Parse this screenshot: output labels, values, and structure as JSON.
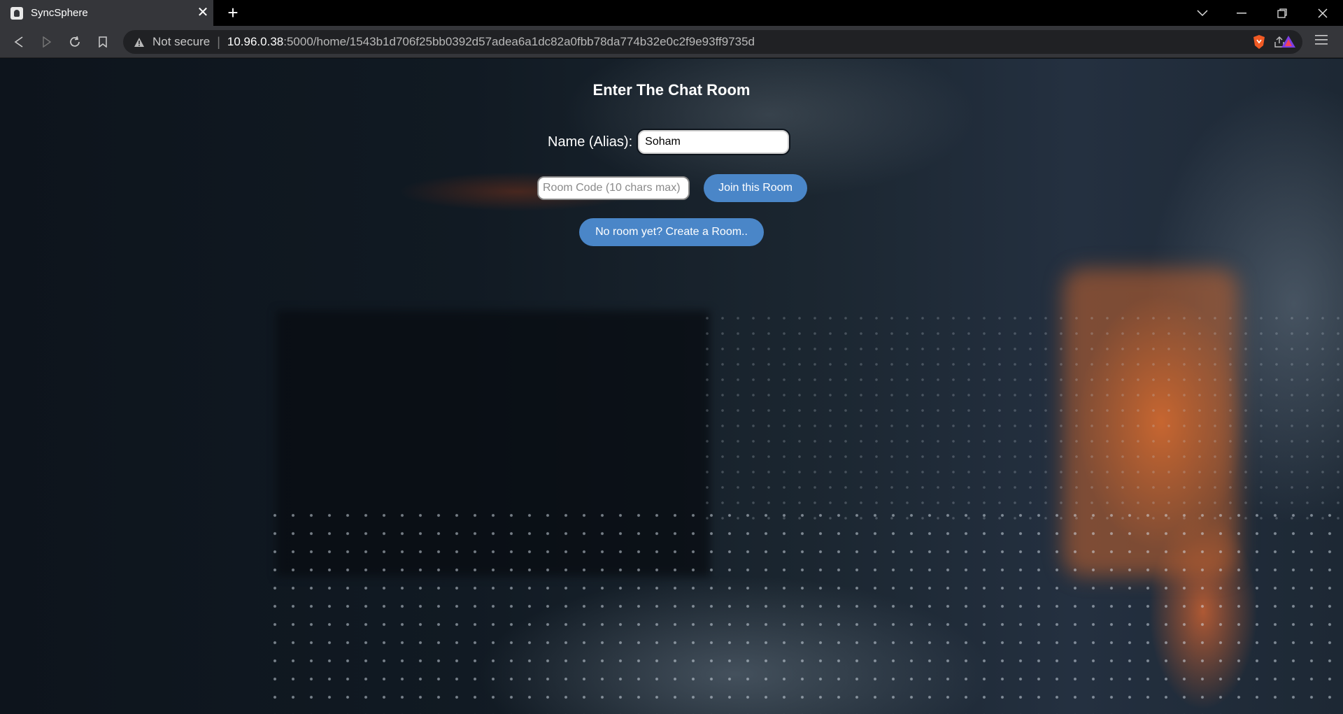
{
  "browser": {
    "tab_title": "SyncSphere",
    "tab_close": "✕",
    "new_tab": "+",
    "security_label": "Not secure",
    "url_host": "10.96.0.38",
    "url_rest": ":5000/home/1543b1d706f25bb0392d57adea6a1dc82a0fbb78da774b32e0c2f9e93ff9735d"
  },
  "page": {
    "heading": "Enter The Chat Room",
    "name_label": "Name (Alias):",
    "name_value": "Soham",
    "room_code_placeholder": "Room Code (10 chars max)",
    "join_button": "Join this Room",
    "create_button": "No room yet? Create a Room.."
  },
  "colors": {
    "button": "#4a86c8",
    "tabbar": "#000000",
    "toolbar": "#35363a"
  },
  "icons": [
    "back-icon",
    "forward-icon",
    "reload-icon",
    "bookmark-icon",
    "warning-icon",
    "share-icon",
    "brave-shield-icon",
    "brave-rewards-icon",
    "menu-icon"
  ]
}
